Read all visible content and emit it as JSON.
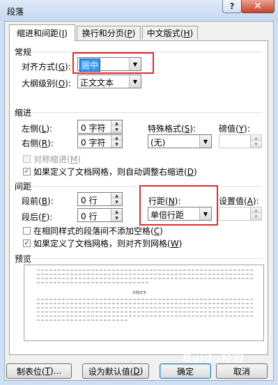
{
  "window": {
    "title": "段落",
    "help_label": "?",
    "close_label": "✕"
  },
  "tabs": [
    {
      "label": "缩进和间距(I)",
      "text": "缩进和间距(",
      "key": "I",
      "suffix": ")"
    },
    {
      "label": "换行和分页(P)",
      "text": "换行和分页(",
      "key": "P",
      "suffix": ")"
    },
    {
      "label": "中文版式(H)",
      "text": "中文版式(",
      "key": "H",
      "suffix": ")"
    }
  ],
  "general": {
    "heading": "常规",
    "alignment": {
      "label": "对齐方式(G):",
      "text": "对齐方式(",
      "key": "G",
      "suffix": "):",
      "value": "居中"
    },
    "outline": {
      "label": "大纲级别(O):",
      "text": "大纲级别(",
      "key": "O",
      "suffix": "):",
      "value": "正文文本"
    }
  },
  "indent": {
    "heading": "缩进",
    "left": {
      "text": "左侧(",
      "key": "L",
      "suffix": "):",
      "value": "0 字符"
    },
    "right": {
      "text": "右侧(",
      "key": "R",
      "suffix": "):",
      "value": "0 字符"
    },
    "special": {
      "text": "特殊格式(",
      "key": "S",
      "suffix": "):",
      "value": "(无)"
    },
    "by": {
      "text": "磅值(",
      "key": "Y",
      "suffix": "):",
      "value": ""
    },
    "mirror": {
      "text": "对称缩进(",
      "key": "M",
      "suffix": ")",
      "checked": false,
      "enabled": false
    },
    "auto_adjust": {
      "text": "如果定义了文档网格，则自动调整右缩进(",
      "key": "D",
      "suffix": ")",
      "checked": true
    }
  },
  "spacing": {
    "heading": "间距",
    "before": {
      "text": "段前(",
      "key": "B",
      "suffix": "):",
      "value": "0 行"
    },
    "after": {
      "text": "段后(",
      "key": "F",
      "suffix": "):",
      "value": "0 行"
    },
    "line_spacing": {
      "text": "行距(",
      "key": "N",
      "suffix": "):",
      "value": "单倍行距"
    },
    "at": {
      "text": "设置值(",
      "key": "A",
      "suffix": "):",
      "value": ""
    },
    "no_space_same_style": {
      "text": "在相同样式的段落间不添加空格(",
      "key": "C",
      "suffix": ")",
      "checked": false
    },
    "snap_to_grid": {
      "text": "如果定义了文档网格，则对齐到网格(",
      "key": "W",
      "suffix": ")",
      "checked": true
    }
  },
  "preview": {
    "heading": "预览",
    "sample": "示例文字"
  },
  "buttons": {
    "tabs": {
      "text": "制表位(",
      "key": "T",
      "suffix": ")..."
    },
    "default": {
      "text": "设为默认值(",
      "key": "D",
      "suffix": ")"
    },
    "ok": "确定",
    "cancel": "取消"
  },
  "watermark": "Baidu经验",
  "colors": {
    "highlight_box": "#e0292b",
    "selection": "#3399ff",
    "title_bar": "#c6d8f0",
    "close_button": "#c7432a"
  }
}
